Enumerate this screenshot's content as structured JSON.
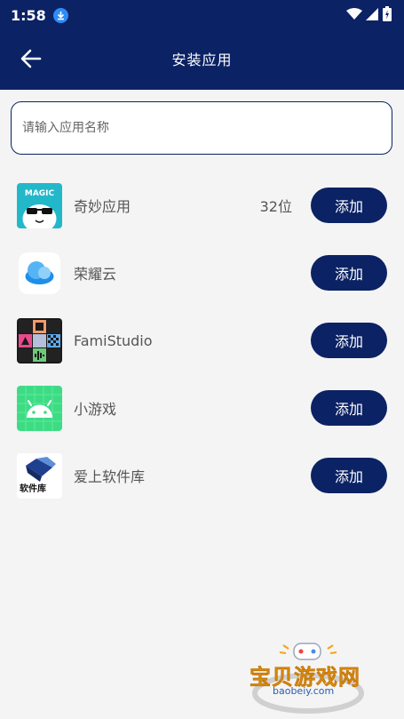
{
  "status": {
    "time": "1:58"
  },
  "header": {
    "title": "安装应用"
  },
  "search": {
    "placeholder": "请输入应用名称"
  },
  "apps": [
    {
      "name": "奇妙应用",
      "count": "32位",
      "button": "添加",
      "icon": "magic-app-icon",
      "icon_text": "MAGIC"
    },
    {
      "name": "荣耀云",
      "count": "",
      "button": "添加",
      "icon": "honor-cloud-icon"
    },
    {
      "name": "FamiStudio",
      "count": "",
      "button": "添加",
      "icon": "famistudio-icon"
    },
    {
      "name": "小游戏",
      "count": "",
      "button": "添加",
      "icon": "android-game-icon"
    },
    {
      "name": "爱上软件库",
      "count": "",
      "button": "添加",
      "icon": "software-library-icon",
      "icon_text": "软件库"
    }
  ],
  "watermark": {
    "text": "宝贝游戏网",
    "url": "baobeiy.com"
  },
  "colors": {
    "primary": "#0b2264",
    "background": "#f4f4f4"
  }
}
